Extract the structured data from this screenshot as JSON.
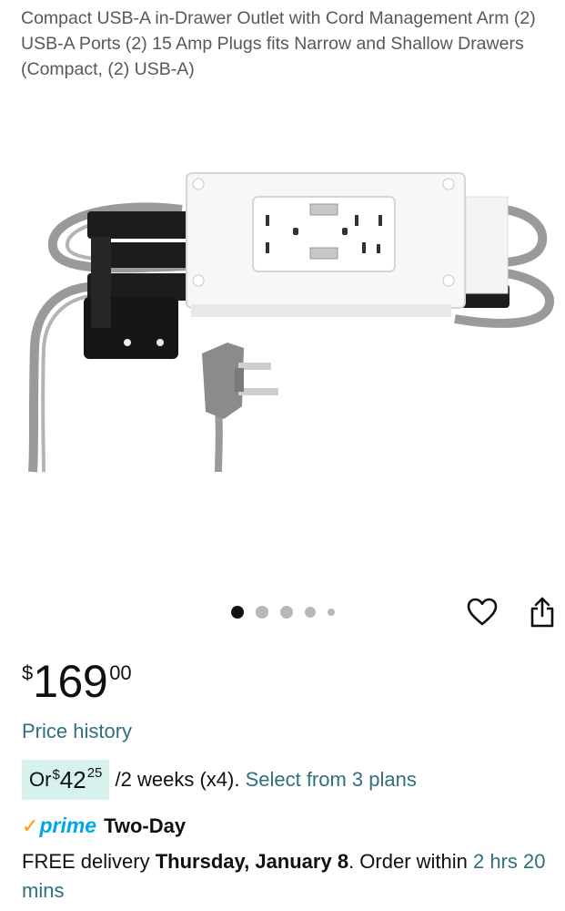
{
  "product": {
    "title": "Compact USB-A in-Drawer Outlet with Cord Management Arm (2) USB-A Ports (2) 15 Amp Plugs fits Narrow and Shallow Drawers (Compact, (2) USB-A)"
  },
  "carousel": {
    "image_icon": "product-photo",
    "dots_total": 5,
    "active_index": 0
  },
  "actions": {
    "wishlist_icon": "heart-icon",
    "share_icon": "share-icon"
  },
  "price": {
    "symbol": "$",
    "whole": "169",
    "fraction": "00"
  },
  "price_history_label": "Price history",
  "installments": {
    "prefix": "Or ",
    "symbol": "$",
    "whole": "42",
    "fraction": "25",
    "terms": " /2 weeks (x4). ",
    "select_link": "Select from 3 plans"
  },
  "prime": {
    "check": "✓",
    "word": "prime",
    "speed": "Two-Day"
  },
  "delivery": {
    "free_text": "FREE delivery ",
    "date": "Thursday, January 8",
    "order_within": ". Order within ",
    "countdown": "2 hrs 20 mins"
  },
  "colors": {
    "link": "#2f6f7e",
    "installment_bg": "#d7f2ec",
    "prime_blue": "#00a8e1",
    "prime_check": "#ff9900"
  }
}
